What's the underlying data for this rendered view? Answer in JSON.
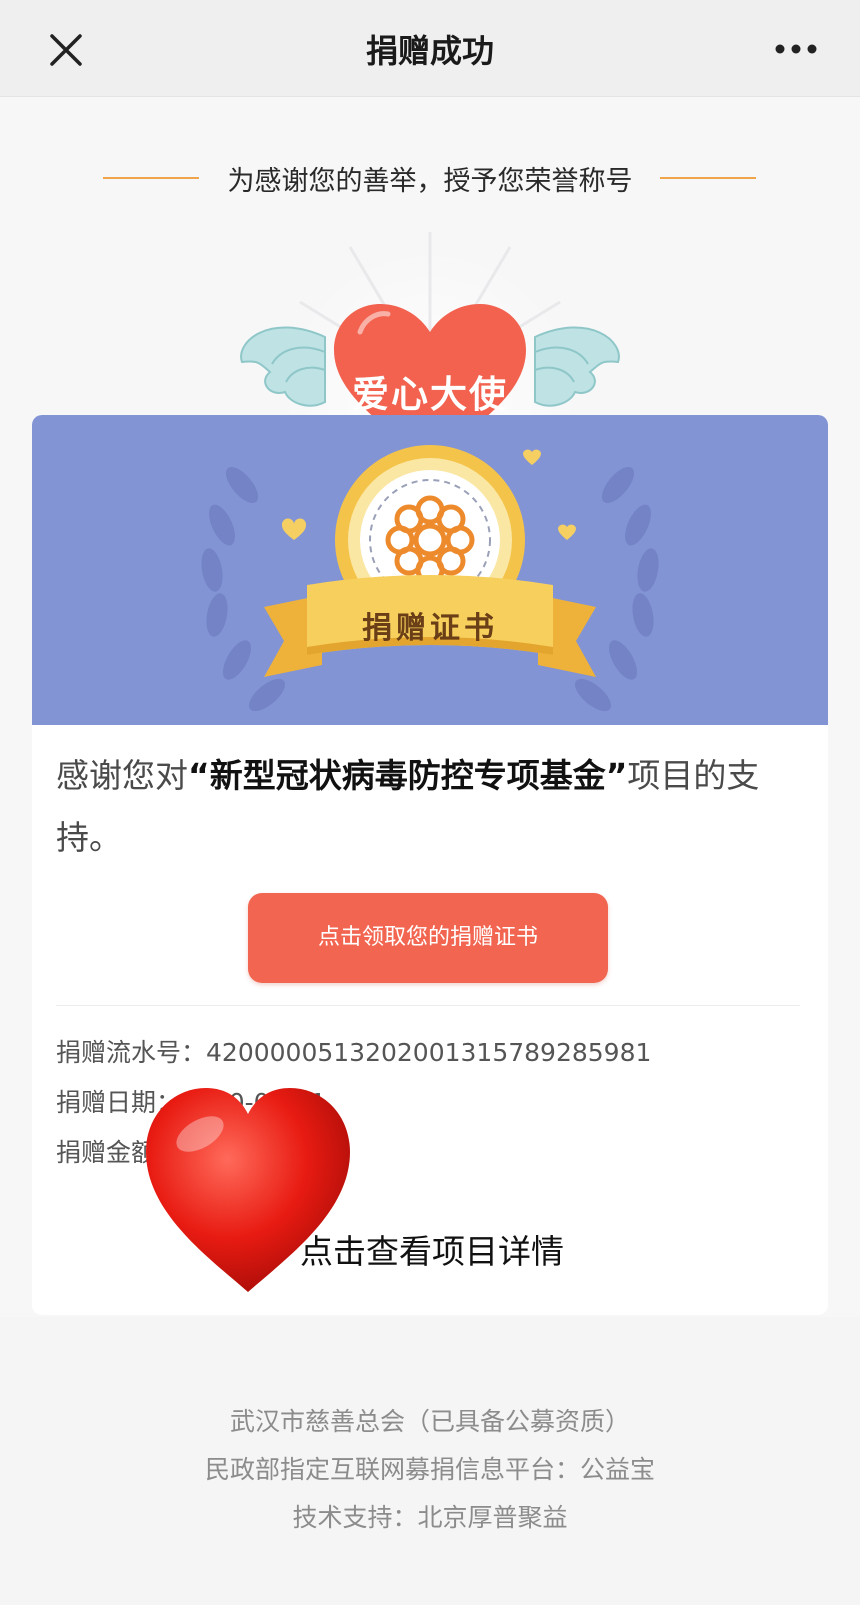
{
  "topbar": {
    "title": "捐赠成功",
    "close_icon": "close-icon",
    "more_icon": "more-icon"
  },
  "honor": {
    "header_text": "为感谢您的善举，授予您荣誉称号",
    "badge_title": "爱心大使"
  },
  "certificate": {
    "banner_label": "捐赠证书",
    "thanks_prefix": "感谢您对",
    "project_name": "“新型冠状病毒防控专项基金”",
    "thanks_suffix": "项目的支持。",
    "claim_button": "点击领取您的捐赠证书",
    "serial_label": "捐赠流水号：",
    "serial_value": "4200000513202001315789285981",
    "date_label": "捐赠日期：",
    "date_value": "2020-01-31",
    "amount_label": "捐赠金额",
    "detail_link": "点击查看项目详情"
  },
  "footer": {
    "line1": "武汉市慈善总会（已具备公募资质）",
    "line2": "民政部指定互联网募捐信息平台：公益宝",
    "line3": "技术支持：北京厚普聚益"
  },
  "colors": {
    "accent": "#f26651",
    "banner": "#8294d4",
    "gold": "#f4c34a"
  }
}
